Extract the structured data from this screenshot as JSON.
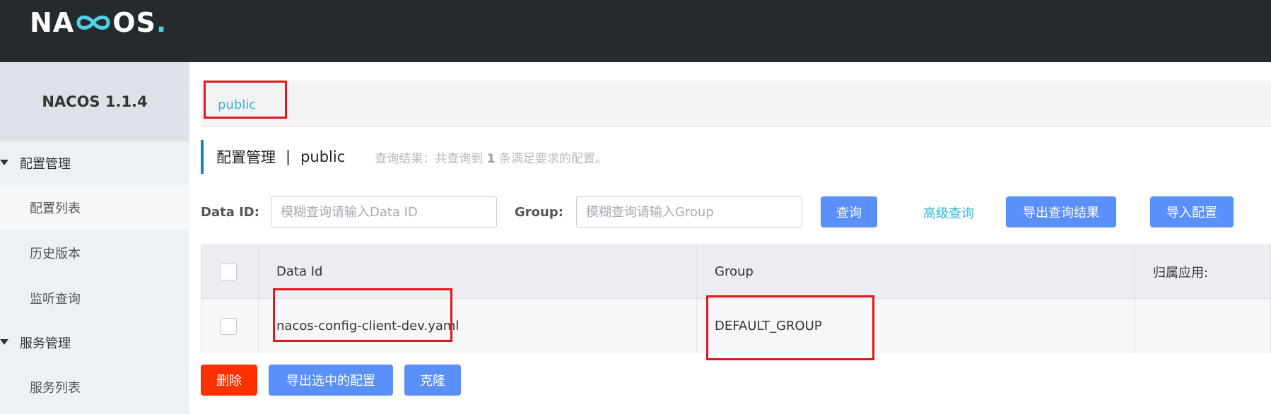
{
  "brand": {
    "logo_text_left": "NA",
    "logo_text_right": "OS",
    "logo_dot": "."
  },
  "sidebar": {
    "version_title": "NACOS 1.1.4",
    "groups": [
      {
        "label": "配置管理",
        "items": [
          "配置列表",
          "历史版本",
          "监听查询"
        ]
      },
      {
        "label": "服务管理",
        "items": [
          "服务列表"
        ]
      }
    ]
  },
  "namespace": {
    "current": "public"
  },
  "page": {
    "title": "配置管理",
    "separator": "|",
    "namespace": "public",
    "result_prefix": "查询结果：共查询到",
    "result_count": "1",
    "result_suffix": "条满足要求的配置。"
  },
  "filters": {
    "data_id_label": "Data ID:",
    "data_id_placeholder": "模糊查询请输入Data ID",
    "group_label": "Group:",
    "group_placeholder": "模糊查询请输入Group",
    "query_button": "查询",
    "advanced_link": "高级查询",
    "export_results_button": "导出查询结果",
    "import_button": "导入配置"
  },
  "table": {
    "columns": [
      "Data Id",
      "Group",
      "归属应用:"
    ],
    "rows": [
      {
        "data_id": "nacos-config-client-dev.yaml",
        "group": "DEFAULT_GROUP",
        "app": ""
      }
    ]
  },
  "actions": {
    "delete_button": "删除",
    "export_selected_button": "导出选中的配置",
    "clone_button": "克隆"
  },
  "colors": {
    "topbar": "#252a2f",
    "primary_button": "#5b8ff9",
    "danger_button": "#ff3000",
    "link": "#33b6d6",
    "highlight_box": "#e3141e"
  }
}
